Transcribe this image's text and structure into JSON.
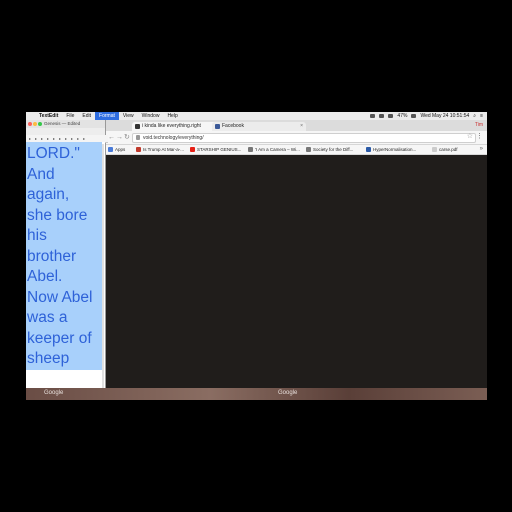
{
  "menubar": {
    "app": "TextEdit",
    "items": [
      "File",
      "Edit",
      "Format",
      "View",
      "Window",
      "Help"
    ],
    "selected": "Format",
    "clock": "Wed May 24  10:51:54",
    "battery": "47%"
  },
  "chrome": {
    "tabs": [
      {
        "label": "i kinda like everything.right",
        "favicon_color": "#333333"
      },
      {
        "label": "Facebook",
        "favicon_color": "#3b5998"
      }
    ],
    "profile": "Tim",
    "url": "void.technology/everything/",
    "bookmarks": [
      {
        "label": "Apps",
        "favicon_color": "#4a7bd8"
      },
      {
        "label": "Is Trump At Mar-a-...",
        "favicon_color": "#c0392b"
      },
      {
        "label": "STARSHIP GENIUS...",
        "favicon_color": "#e62117"
      },
      {
        "label": "'I Am a Camera – Wi...",
        "favicon_color": "#777777"
      },
      {
        "label": "Society for the Diff...",
        "favicon_color": "#777777"
      },
      {
        "label": "HyperNormalisation...",
        "favicon_color": "#2b5aa7"
      },
      {
        "label": "carse.pdf",
        "favicon_color": "#cccccc"
      }
    ],
    "more_glyph": "»"
  },
  "textedit": {
    "title": "Genesis — Edited",
    "style_box": "Helvetica",
    "text_lines": [
      "LORD.\"",
      "And",
      "again,",
      "she bore",
      "his",
      "brother",
      "Abel.",
      "Now Abel",
      "was a",
      "keeper of",
      "sheep"
    ]
  },
  "dock": {
    "labels": [
      "Google",
      "Google"
    ]
  }
}
